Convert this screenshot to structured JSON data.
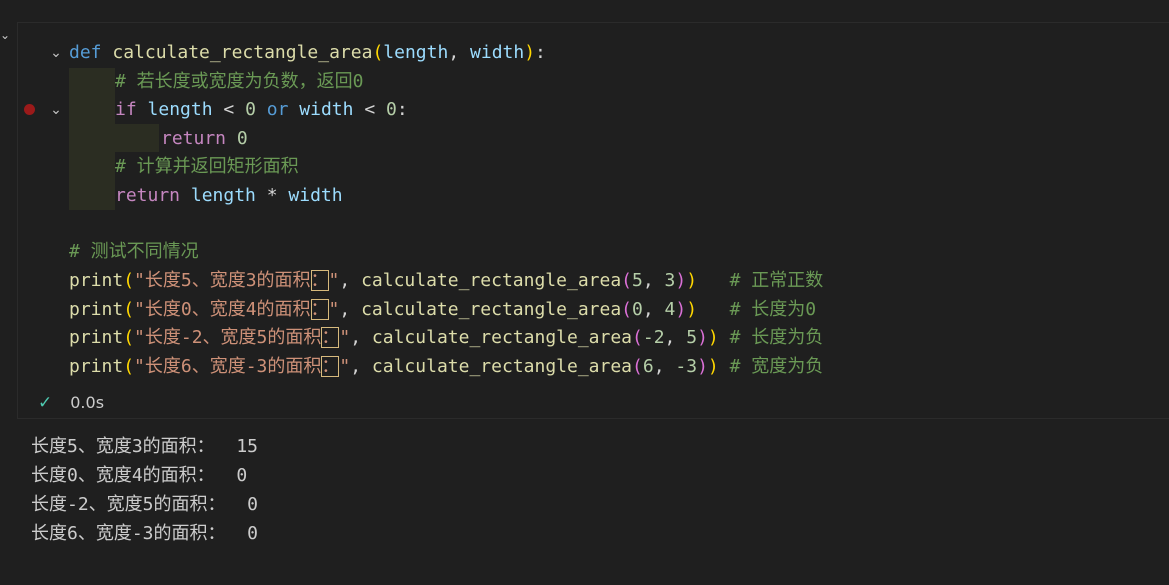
{
  "cell": {
    "status_time": "0.0s"
  },
  "code": {
    "lines": [
      {
        "tokens": [
          [
            "kw-blue",
            "def"
          ],
          [
            "op",
            " "
          ],
          [
            "fn",
            "calculate_rectangle_area"
          ],
          [
            "br1",
            "("
          ],
          [
            "var",
            "length"
          ],
          [
            "op",
            ", "
          ],
          [
            "var",
            "width"
          ],
          [
            "br1",
            ")"
          ],
          [
            "op",
            ":"
          ]
        ]
      },
      {
        "tokens": [
          [
            "cmt",
            "# 若长度或宽度为负数，返回0"
          ]
        ]
      },
      {
        "tokens": [
          [
            "kw-ctrl",
            "if"
          ],
          [
            "op",
            " "
          ],
          [
            "var",
            "length"
          ],
          [
            "op",
            " < "
          ],
          [
            "num",
            "0"
          ],
          [
            "op",
            " "
          ],
          [
            "kw-blue",
            "or"
          ],
          [
            "op",
            " "
          ],
          [
            "var",
            "width"
          ],
          [
            "op",
            " < "
          ],
          [
            "num",
            "0"
          ],
          [
            "op",
            ":"
          ]
        ]
      },
      {
        "tokens": [
          [
            "kw-ctrl",
            "return"
          ],
          [
            "op",
            " "
          ],
          [
            "num",
            "0"
          ]
        ]
      },
      {
        "tokens": [
          [
            "cmt",
            "# 计算并返回矩形面积"
          ]
        ]
      },
      {
        "tokens": [
          [
            "kw-ctrl",
            "return"
          ],
          [
            "op",
            " "
          ],
          [
            "var",
            "length"
          ],
          [
            "op",
            " * "
          ],
          [
            "var",
            "width"
          ]
        ]
      },
      {
        "tokens": []
      },
      {
        "tokens": [
          [
            "cmt",
            "# 测试不同情况"
          ]
        ]
      },
      {
        "tokens": [
          [
            "fn",
            "print"
          ],
          [
            "br1",
            "("
          ],
          [
            "str",
            "\"长度5、宽度3的面积"
          ],
          [
            "str hl",
            "："
          ],
          [
            "str",
            "\""
          ],
          [
            "op",
            ", "
          ],
          [
            "fn",
            "calculate_rectangle_area"
          ],
          [
            "br2",
            "("
          ],
          [
            "num",
            "5"
          ],
          [
            "op",
            ", "
          ],
          [
            "num",
            "3"
          ],
          [
            "br2",
            ")"
          ],
          [
            "br1",
            ")"
          ],
          [
            "op",
            "   "
          ],
          [
            "cmt",
            "# 正常正数"
          ]
        ]
      },
      {
        "tokens": [
          [
            "fn",
            "print"
          ],
          [
            "br1",
            "("
          ],
          [
            "str",
            "\"长度0、宽度4的面积"
          ],
          [
            "str hl",
            "："
          ],
          [
            "str",
            "\""
          ],
          [
            "op",
            ", "
          ],
          [
            "fn",
            "calculate_rectangle_area"
          ],
          [
            "br2",
            "("
          ],
          [
            "num",
            "0"
          ],
          [
            "op",
            ", "
          ],
          [
            "num",
            "4"
          ],
          [
            "br2",
            ")"
          ],
          [
            "br1",
            ")"
          ],
          [
            "op",
            "   "
          ],
          [
            "cmt",
            "# 长度为0"
          ]
        ]
      },
      {
        "tokens": [
          [
            "fn",
            "print"
          ],
          [
            "br1",
            "("
          ],
          [
            "str",
            "\"长度-2、宽度5的面积"
          ],
          [
            "str hl",
            "："
          ],
          [
            "str",
            "\""
          ],
          [
            "op",
            ", "
          ],
          [
            "fn",
            "calculate_rectangle_area"
          ],
          [
            "br2",
            "("
          ],
          [
            "num",
            "-2"
          ],
          [
            "op",
            ", "
          ],
          [
            "num",
            "5"
          ],
          [
            "br2",
            ")"
          ],
          [
            "br1",
            ")"
          ],
          [
            "op",
            " "
          ],
          [
            "cmt",
            "# 长度为负"
          ]
        ]
      },
      {
        "tokens": [
          [
            "fn",
            "print"
          ],
          [
            "br1",
            "("
          ],
          [
            "str",
            "\"长度6、宽度-3的面积"
          ],
          [
            "str hl",
            "："
          ],
          [
            "str",
            "\""
          ],
          [
            "op",
            ", "
          ],
          [
            "fn",
            "calculate_rectangle_area"
          ],
          [
            "br2",
            "("
          ],
          [
            "num",
            "6"
          ],
          [
            "op",
            ", "
          ],
          [
            "num",
            "-3"
          ],
          [
            "br2",
            ")"
          ],
          [
            "br1",
            ")"
          ],
          [
            "op",
            " "
          ],
          [
            "cmt",
            "# 宽度为负"
          ]
        ]
      }
    ]
  },
  "output": {
    "lines": [
      "长度5、宽度3的面积：  15",
      "长度0、宽度4的面积：  0",
      "长度-2、宽度5的面积：  0",
      "长度6、宽度-3的面积：  0"
    ]
  },
  "icons": {
    "chevron": "chevron-down-icon",
    "fold": "fold-chevron-icon",
    "check": "check-icon",
    "breakpoint": "breakpoint-icon"
  },
  "colors": {
    "background": "#1f1f1f",
    "keyword": "#569cd6",
    "control": "#c586c0",
    "function": "#dcdcaa",
    "variable": "#9cdcfe",
    "number": "#b5cea8",
    "string": "#ce9178",
    "comment": "#6a9955",
    "breakpoint": "#9b1a1a",
    "success": "#4ec9b0"
  }
}
